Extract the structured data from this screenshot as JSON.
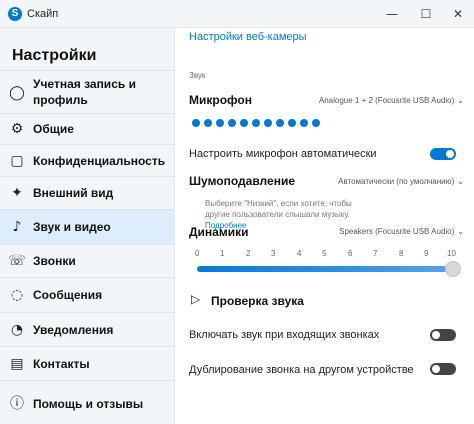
{
  "window": {
    "title": "Скайп",
    "minimize": "—",
    "maximize": "☐",
    "close": "✕"
  },
  "sidebar": {
    "title": "Настройки",
    "items": [
      {
        "label": "Учетная запись и профиль",
        "icon": "account-icon",
        "glyph": "◯",
        "active": false
      },
      {
        "label": "Общие",
        "icon": "gear-icon",
        "glyph": "⚙",
        "active": false
      },
      {
        "label": "Конфиденциальность",
        "icon": "lock-icon",
        "glyph": "▢",
        "active": false
      },
      {
        "label": "Внешний вид",
        "icon": "wand-icon",
        "glyph": "✦",
        "active": false
      },
      {
        "label": "Звук и видео",
        "icon": "microphone-icon",
        "glyph": "♪",
        "active": true
      },
      {
        "label": "Звонки",
        "icon": "phone-icon",
        "glyph": "☏",
        "active": false
      },
      {
        "label": "Сообщения",
        "icon": "chat-icon",
        "glyph": "◌",
        "active": false
      },
      {
        "label": "Уведомления",
        "icon": "bell-icon",
        "glyph": "◔",
        "active": false
      },
      {
        "label": "Контакты",
        "icon": "contacts-icon",
        "glyph": "▤",
        "active": false
      },
      {
        "label": "Помощь и отзывы",
        "icon": "help-icon",
        "glyph": "ⓘ",
        "active": false
      }
    ]
  },
  "main": {
    "webcam_link": "Настройки веб-камеры",
    "sound_caption": "Звук",
    "microphone": {
      "title": "Микрофон",
      "device": "Analogue 1 + 2 (Focusrite USB Audio)",
      "level_dots": 11,
      "auto_label": "Настроить микрофон автоматически",
      "auto_enabled": true
    },
    "noise": {
      "title": "Шумоподавление",
      "value": "Автоматически (по умолчанию)",
      "hint": "Выберите \"Низкий\", если хотите, чтобы другие пользователи слышали музыку.",
      "hint_link": "Подробнее"
    },
    "speakers": {
      "title": "Динамики",
      "device": "Speakers (Focusrite USB Audio)",
      "ticks": [
        "0",
        "1",
        "2",
        "3",
        "4",
        "5",
        "6",
        "7",
        "8",
        "9",
        "10"
      ],
      "volume": 10
    },
    "test_sound": "Проверка звука",
    "incoming_label": "Включать звук при входящих звонках",
    "incoming_enabled": false,
    "duplicate_label": "Дублирование звонка на другом устройстве",
    "duplicate_enabled": false
  },
  "colors": {
    "accent": "#0078d4",
    "sidebar_bg": "#f3f6f9",
    "active_item_bg": "#ddedfb"
  }
}
